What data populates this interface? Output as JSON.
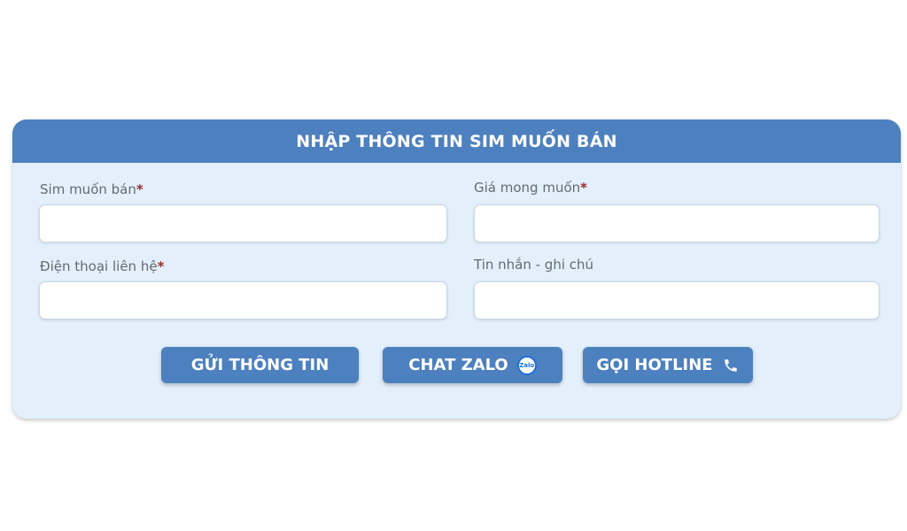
{
  "form": {
    "title": "NHẬP THÔNG TIN SIM MUỐN BÁN",
    "required_mark": "*",
    "fields": {
      "sim": {
        "label": "Sim muốn bán",
        "value": "",
        "placeholder": ""
      },
      "price": {
        "label": "Giá mong muốn",
        "value": "",
        "placeholder": ""
      },
      "phone": {
        "label": "Điện thoại liên hệ",
        "value": "",
        "placeholder": ""
      },
      "note": {
        "label": "Tin nhắn - ghi chú",
        "value": "",
        "placeholder": ""
      }
    }
  },
  "buttons": {
    "submit": {
      "label": "GỬI THÔNG TIN"
    },
    "zalo": {
      "label": "CHAT ZALO",
      "icon": "zalo-icon",
      "icon_text": "Zalo"
    },
    "hotline": {
      "label": "GỌI HOTLINE",
      "icon": "phone-icon"
    }
  },
  "colors": {
    "primary": "#4d80bf",
    "panel_bg": "#e3f0fb",
    "required": "#9b2c2c"
  }
}
